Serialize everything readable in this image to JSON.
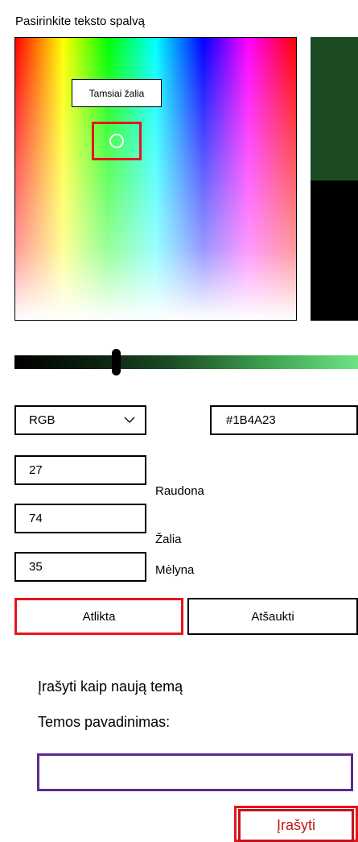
{
  "dialog": {
    "title": "Pasirinkite teksto spalvą"
  },
  "picker": {
    "tooltip": "Tamsiai žalia",
    "selected_color": "#1B4A23",
    "previous_color": "#000000"
  },
  "color_mode": {
    "selected": "RGB"
  },
  "hex_value": "#1B4A23",
  "channels": {
    "red": {
      "value": "27",
      "label": "Raudona"
    },
    "green": {
      "value": "74",
      "label": "Žalia"
    },
    "blue": {
      "value": "35",
      "label": "Mėlyna"
    }
  },
  "buttons": {
    "done": "Atlikta",
    "cancel": "Atšaukti",
    "save": "Įrašyti"
  },
  "theme": {
    "save_as_new": "Įrašyti kaip naują temą",
    "name_label": "Temos pavadinimas:",
    "name_value": ""
  },
  "accent_colors": {
    "highlight": "#e8141b",
    "input_focus": "#5b2c8f"
  },
  "icons": {
    "dropdown": "chevron-down-icon"
  }
}
